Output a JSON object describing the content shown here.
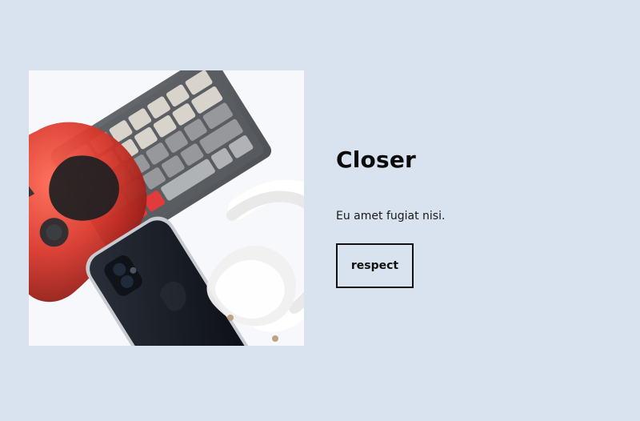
{
  "card": {
    "title": "Closer",
    "description": "Eu amet fugiat nisi.",
    "button_label": "respect"
  },
  "image": {
    "subject": "gamepad-keyboard-phone-headphones-photo"
  },
  "colors": {
    "background": "#d9e2ef",
    "text": "#111111",
    "controller_red": "#d6382b",
    "keyboard_gray": "#5b5d61",
    "keycap_light": "#d9d6cd",
    "accent_keys": "#e23b3b",
    "phone": "#141821",
    "headphones": "#f2f2f2"
  }
}
